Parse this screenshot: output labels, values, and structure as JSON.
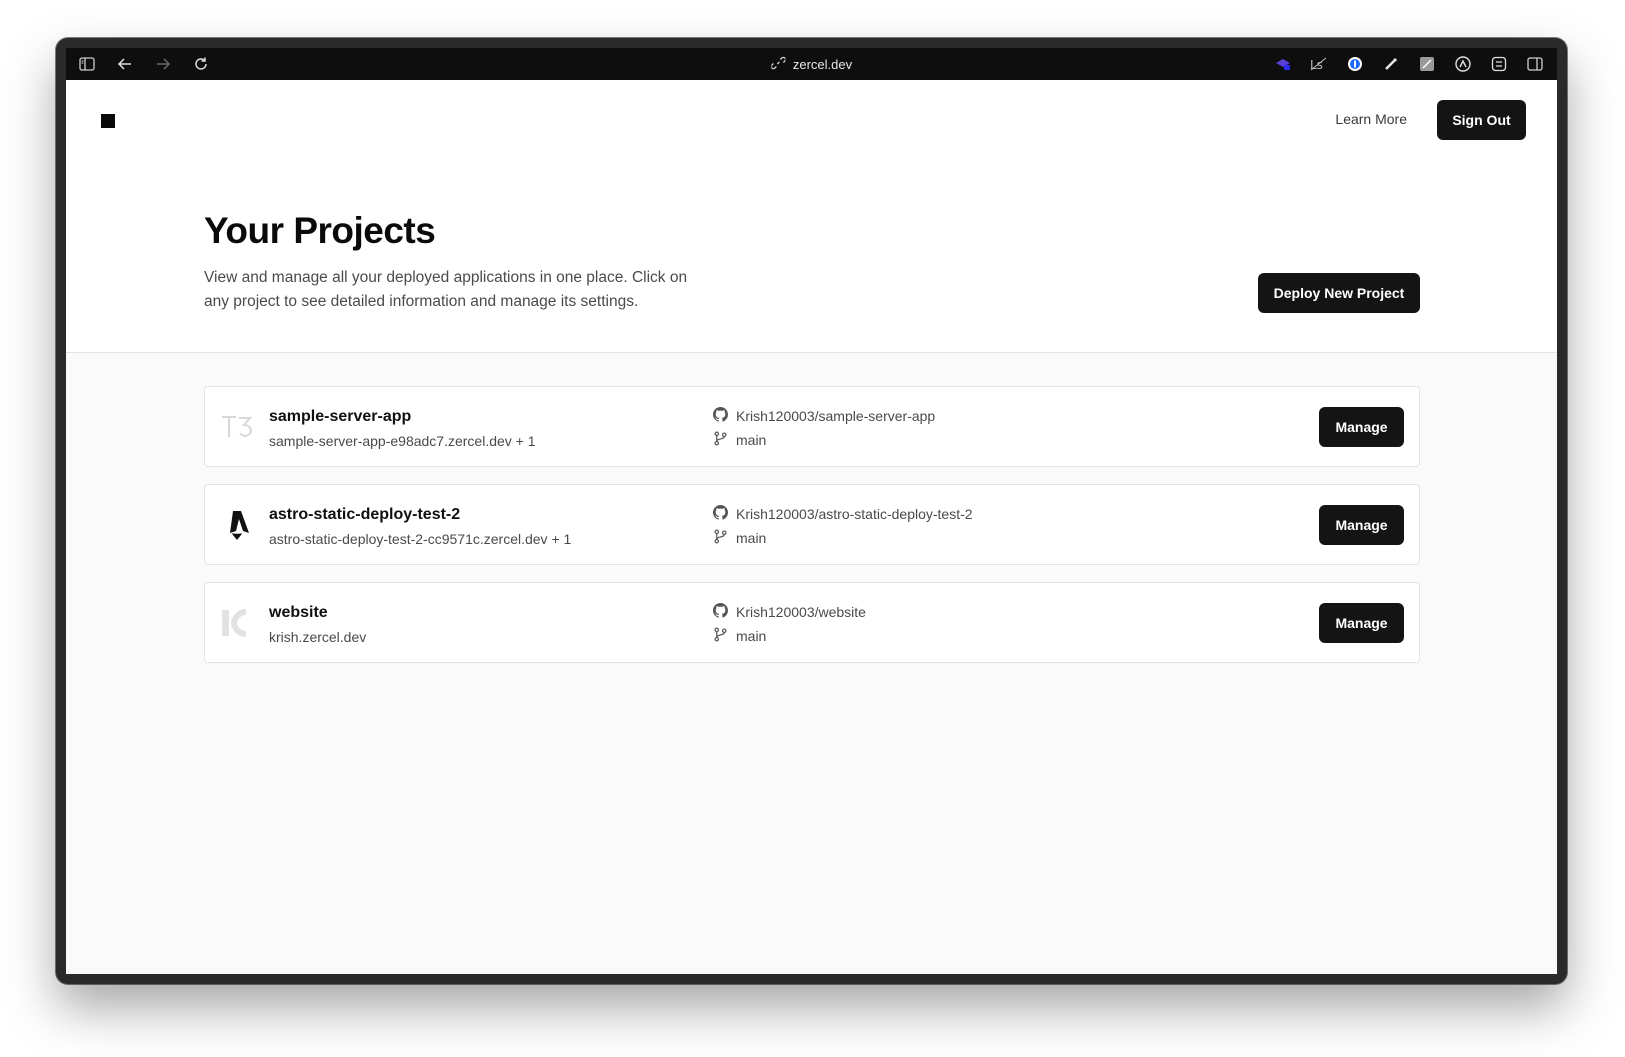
{
  "browser": {
    "url": "zercel.dev",
    "icons": [
      "sidebar-icon",
      "back-icon",
      "forward-icon",
      "reload-icon",
      "link-icon"
    ],
    "extensions": [
      "extension-hat-icon",
      "extension-ls-icon",
      "password-manager-icon",
      "extension-wand-icon",
      "extension-note-icon",
      "extension-a-icon",
      "extension-box-icon",
      "split-view-icon"
    ]
  },
  "nav": {
    "learn_more": "Learn More",
    "sign_out": "Sign Out"
  },
  "page": {
    "title": "Your Projects",
    "description": "View and manage all your deployed applications in one place. Click on any project to see detailed information and manage its settings.",
    "deploy_button": "Deploy New Project"
  },
  "projects": [
    {
      "name": "sample-server-app",
      "domain": "sample-server-app-e98adc7.zercel.dev + 1",
      "repo": "Krish120003/sample-server-app",
      "branch": "main",
      "manage": "Manage",
      "icon": "t3-logo-icon"
    },
    {
      "name": "astro-static-deploy-test-2",
      "domain": "astro-static-deploy-test-2-cc9571c.zercel.dev + 1",
      "repo": "Krish120003/astro-static-deploy-test-2",
      "branch": "main",
      "manage": "Manage",
      "icon": "astro-logo-icon"
    },
    {
      "name": "website",
      "domain": "krish.zercel.dev",
      "repo": "Krish120003/website",
      "branch": "main",
      "manage": "Manage",
      "icon": "k-logo-icon"
    }
  ],
  "colors": {
    "button": "#141414",
    "page_bg": "#fafafa",
    "card_border": "#e4e4e4",
    "text_muted": "#4a4a4a"
  }
}
